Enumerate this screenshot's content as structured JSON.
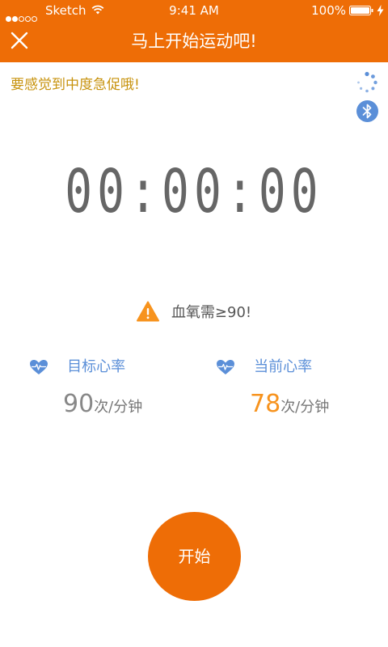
{
  "status_bar": {
    "carrier": "Sketch",
    "time": "9:41 AM",
    "battery": "100%"
  },
  "nav": {
    "title": "马上开始运动吧!"
  },
  "hint": "要感觉到中度急促哦!",
  "timer": "00:00:00",
  "warning": "血氧需≥90!",
  "target_hr": {
    "label": "目标心率",
    "value": "90",
    "unit": "次/分钟"
  },
  "current_hr": {
    "label": "当前心率",
    "value": "78",
    "unit": "次/分钟"
  },
  "start_button": "开始",
  "colors": {
    "primary": "#EE6D06",
    "hint": "#C7920C",
    "accent_blue": "#5B8FD8",
    "value_orange": "#F7931E",
    "warning": "#F7931E"
  },
  "icons": [
    "signal-icon",
    "wifi-icon",
    "battery-icon",
    "charging-bolt-icon",
    "close-icon",
    "loading-spinner-icon",
    "bluetooth-icon",
    "warning-icon",
    "heart-pulse-icon"
  ]
}
